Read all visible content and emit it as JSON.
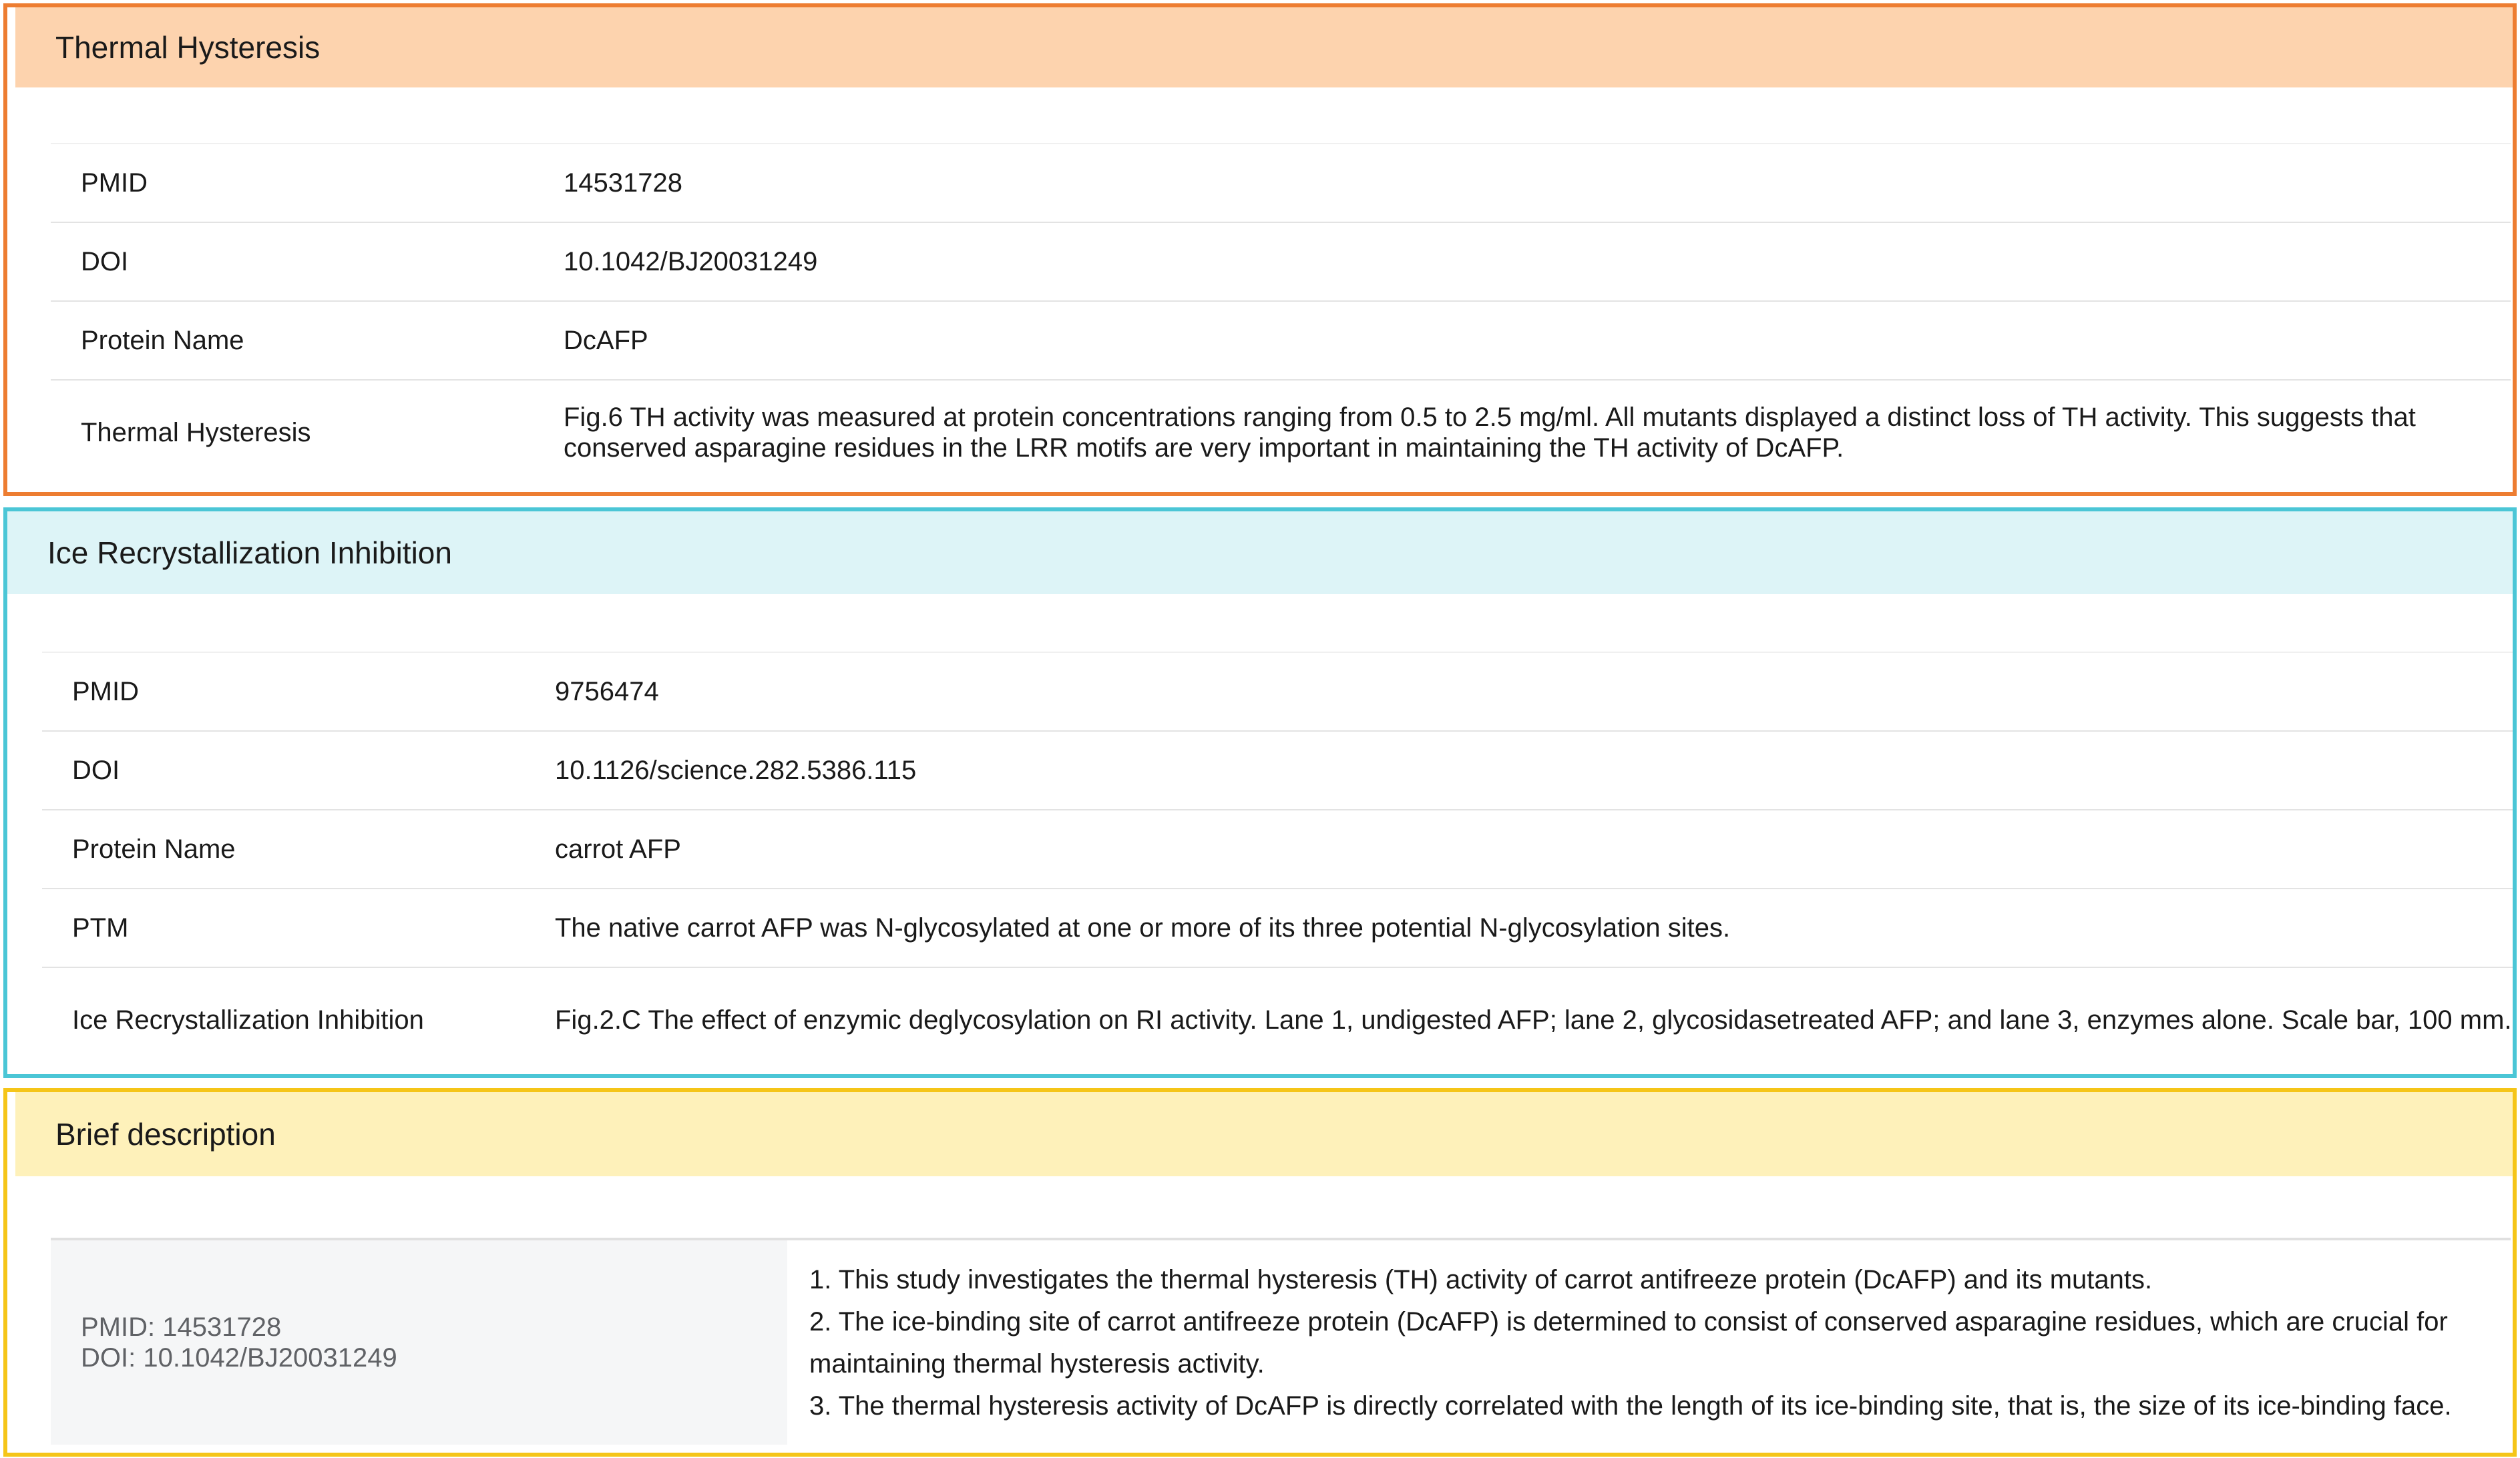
{
  "thermal_hysteresis": {
    "title": "Thermal Hysteresis",
    "rows": [
      {
        "key": "PMID",
        "value": "14531728"
      },
      {
        "key": "DOI",
        "value": "10.1042/BJ20031249"
      },
      {
        "key": "Protein Name",
        "value": "DcAFP"
      },
      {
        "key": "Thermal Hysteresis",
        "value": "Fig.6 TH activity was measured at protein concentrations ranging from 0.5 to 2.5 mg/ml. All mutants displayed a distinct loss of TH activity. This suggests that conserved asparagine residues in the LRR motifs are very important in maintaining the TH activity of DcAFP."
      }
    ]
  },
  "ice_recrystallization": {
    "title": "Ice Recrystallization Inhibition",
    "rows": [
      {
        "key": "PMID",
        "value": "9756474"
      },
      {
        "key": "DOI",
        "value": "10.1126/science.282.5386.115"
      },
      {
        "key": "Protein Name",
        "value": "carrot AFP"
      },
      {
        "key": "PTM",
        "value": "The native carrot AFP was N-glycosylated at one or more of its three potential N-glycosylation sites."
      },
      {
        "key": "Ice Recrystallization Inhibition",
        "value": "Fig.2.C The effect of enzymic deglycosylation on RI activity. Lane 1, undigested AFP; lane 2, glycosidasetreated AFP; and lane 3, enzymes alone. Scale bar, 100 mm."
      }
    ]
  },
  "brief_description": {
    "title": "Brief description",
    "pmid_line": "PMID: 14531728",
    "doi_line": "DOI: 10.1042/BJ20031249",
    "points": [
      "1. This study investigates the thermal hysteresis (TH) activity of carrot antifreeze protein (DcAFP) and its mutants.",
      "2. The ice-binding site of carrot antifreeze protein (DcAFP) is determined to consist of conserved asparagine residues, which are crucial for maintaining thermal hysteresis activity.",
      "3. The thermal hysteresis activity of DcAFP is directly correlated with the length of its ice-binding site, that is, the size of its ice-binding face."
    ]
  },
  "colors": {
    "th_border": "#ED7D31",
    "th_header": "#FDD3AE",
    "iri_border": "#4BC6D6",
    "iri_header": "#DDF4F7",
    "bd_border": "#F5C518",
    "bd_header": "#FEF1BA"
  }
}
